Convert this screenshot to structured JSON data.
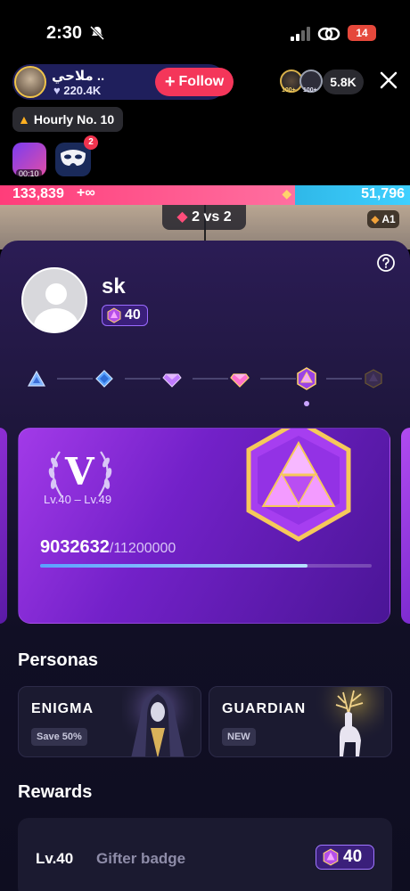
{
  "status_bar": {
    "time": "2:30",
    "battery": "14"
  },
  "host": {
    "name": "ملاحي ..",
    "likes": "220.4K",
    "follow_label": "Follow"
  },
  "viewers": {
    "count": "5.8K",
    "badge_left": "100+",
    "badge_right": "100+"
  },
  "hourly": {
    "label": "Hourly No. 10"
  },
  "gift": {
    "timer": "00:10",
    "mask_badge": "2"
  },
  "pk": {
    "left_score": "133,839",
    "right_score": "51,796",
    "mode": "2 vs 2",
    "tag": "A1"
  },
  "profile": {
    "username": "sk",
    "level": "40"
  },
  "vip_card": {
    "letter": "V",
    "range": "Lv.40 – Lv.49",
    "current": "9032632",
    "target": "/11200000",
    "progress": 0.806
  },
  "personas": {
    "title": "Personas",
    "items": [
      {
        "name": "ENIGMA",
        "tag": "Save 50%"
      },
      {
        "name": "GUARDIAN",
        "tag": "NEW"
      }
    ]
  },
  "rewards": {
    "title": "Rewards",
    "rows": [
      {
        "level": "Lv.40",
        "name": "Gifter badge",
        "badge": "40"
      }
    ]
  }
}
